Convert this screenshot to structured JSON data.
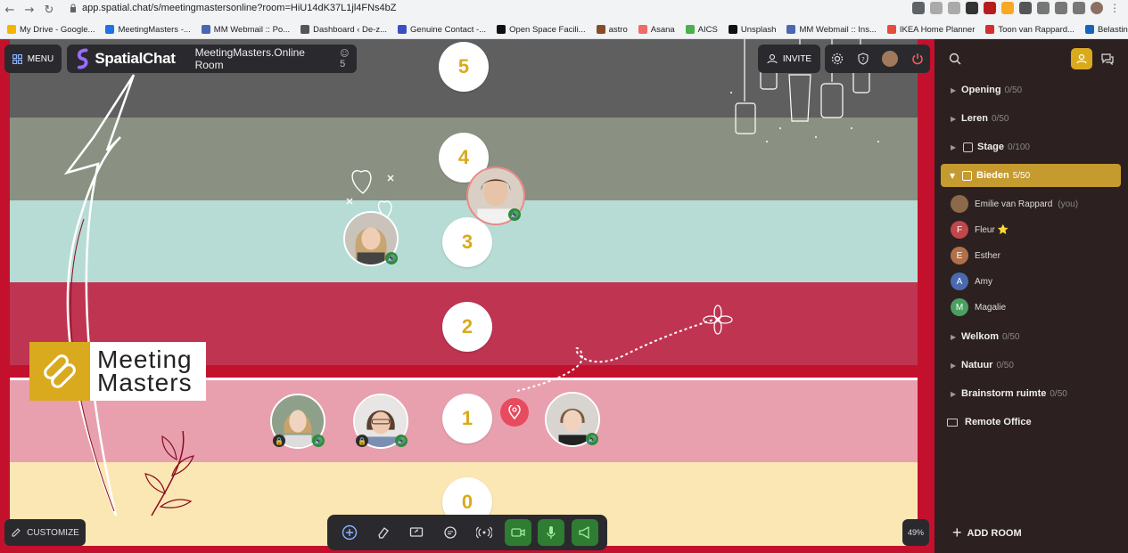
{
  "browser": {
    "url": "app.spatial.chat/s/meetingmastersonline?room=HiU14dK37L1jl4FNs4bZ",
    "bookmarks": [
      {
        "label": "My Drive - Google...",
        "color": "#f4b400"
      },
      {
        "label": "MeetingMasters -...",
        "color": "#1a73e8"
      },
      {
        "label": "MM Webmail :: Po...",
        "color": "#4a67b0"
      },
      {
        "label": "Dashboard ‹ De-z...",
        "color": "#555555"
      },
      {
        "label": "Genuine Contact -...",
        "color": "#3c4fbf"
      },
      {
        "label": "Open Space Facili...",
        "color": "#111111"
      },
      {
        "label": "astro",
        "color": "#8a4b2a"
      },
      {
        "label": "Asana",
        "color": "#f06a6a"
      },
      {
        "label": "AICS",
        "color": "#4caf50"
      },
      {
        "label": "Unsplash",
        "color": "#111111"
      },
      {
        "label": "MM Webmail :: Ins...",
        "color": "#4a67b0"
      },
      {
        "label": "IKEA Home Planner",
        "color": "#e94b3c"
      },
      {
        "label": "Toon van Rappard...",
        "color": "#d32f2f"
      },
      {
        "label": "Belastingdienst -...",
        "color": "#1565c0"
      }
    ]
  },
  "header": {
    "menu_label": "MENU",
    "brand": "SpatialChat",
    "room_title": "MeetingMasters.Online Room",
    "participant_count": "5",
    "invite_label": "INVITE"
  },
  "stage": {
    "levels": [
      "5",
      "4",
      "3",
      "2",
      "1",
      "0"
    ],
    "logo_line1": "Meeting",
    "logo_line2": "Masters",
    "colors": {
      "frame": "#c3112d",
      "accent": "#d9aa1e"
    }
  },
  "bottom": {
    "customize_label": "CUSTOMIZE",
    "zoom": "49%"
  },
  "sidebar": {
    "rooms_top": [
      {
        "name": "Opening",
        "count": "0/50"
      },
      {
        "name": "Leren",
        "count": "0/50"
      },
      {
        "name": "Stage",
        "count": "0/100"
      }
    ],
    "active_room": {
      "name": "Bieden",
      "count": "5/50"
    },
    "members": [
      {
        "name": "Emilie van Rappard",
        "suffix": "(you)",
        "initial": "",
        "color": "#8a6a4a"
      },
      {
        "name": "Fleur ⭐",
        "suffix": "",
        "initial": "F",
        "color": "#c0474a"
      },
      {
        "name": "Esther",
        "suffix": "",
        "initial": "E",
        "color": "#b0704a"
      },
      {
        "name": "Amy",
        "suffix": "",
        "initial": "A",
        "color": "#4a6ab0"
      },
      {
        "name": "Magalie",
        "suffix": "",
        "initial": "M",
        "color": "#4aa060"
      }
    ],
    "rooms_bottom": [
      {
        "name": "Welkom",
        "count": "0/50"
      },
      {
        "name": "Natuur",
        "count": "0/50"
      },
      {
        "name": "Brainstorm ruimte",
        "count": "0/50"
      }
    ],
    "folder_label": "Remote Office",
    "add_room_label": "ADD ROOM"
  }
}
